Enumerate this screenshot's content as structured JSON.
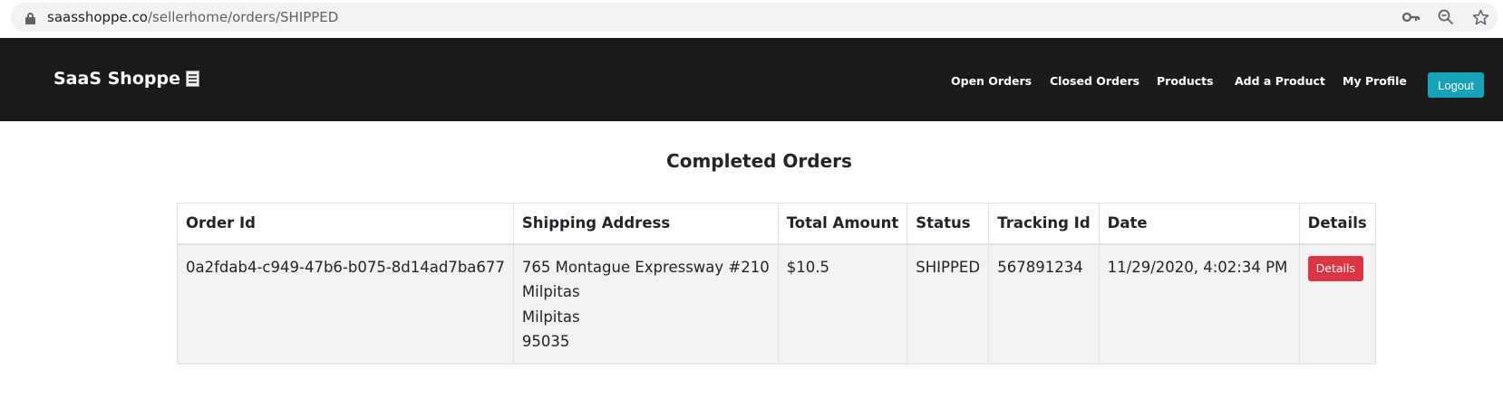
{
  "browser": {
    "url_domain": "saasshoppe.co",
    "url_path": "/sellerhome/orders/SHIPPED",
    "icons": [
      "key-icon",
      "zoom-icon",
      "star-icon"
    ]
  },
  "navbar": {
    "brand": "SaaS Shoppe",
    "brand_icon": "notepad-icon",
    "links": [
      "Open Orders",
      "Closed Orders",
      "Products",
      "Add a Product",
      "My Profile"
    ],
    "logout_label": "Logout",
    "background": "#1b1b1b",
    "logout_color": "#17a2b8"
  },
  "main": {
    "title": "Completed Orders",
    "table": {
      "headers": [
        "Order Id",
        "Shipping Address",
        "Total Amount",
        "Status",
        "Tracking Id",
        "Date",
        "Details"
      ],
      "rows": [
        {
          "order_id": "0a2fdab4-c949-47b6-b075-8d14ad7ba677",
          "address": [
            "765 Montague Expressway #210",
            "Milpitas",
            "Milpitas",
            "95035"
          ],
          "total": "$10.5",
          "status": "SHIPPED",
          "tracking_id": "567891234",
          "date": "11/29/2020, 4:02:34 PM",
          "details_label": "Details"
        }
      ]
    },
    "details_button_color": "#dc3545"
  }
}
